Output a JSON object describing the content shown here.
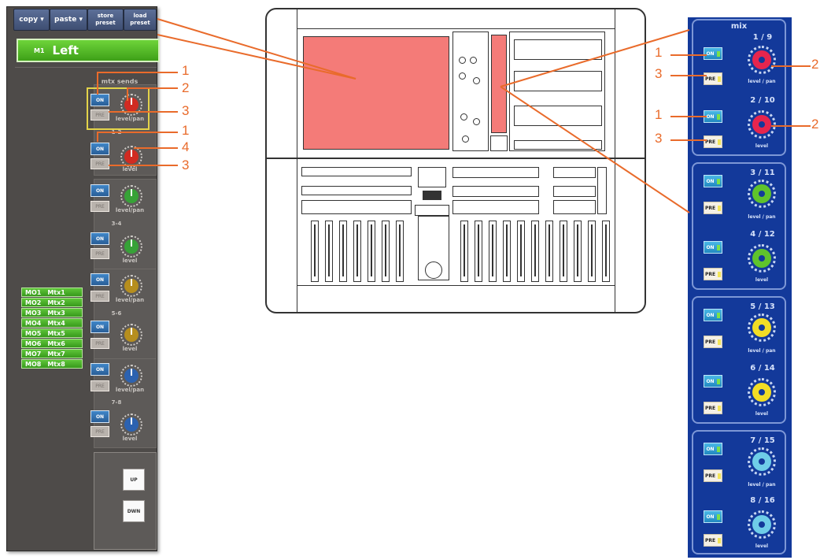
{
  "colors": {
    "callout": "#e96b2b",
    "highlight": "#f47b78",
    "left_strip": "#4e4b49",
    "right_panel": "#13399a",
    "channel_green": "#4fb828"
  },
  "left_strip": {
    "toolbar": {
      "copy": "copy",
      "paste": "paste",
      "store_preset": "store preset",
      "load_preset": "load preset"
    },
    "channel": {
      "index": "M1",
      "name": "Left"
    },
    "mtx_sends_title": "mtx sends",
    "pairs": [
      {
        "label": "1-2",
        "knob_color": "#d12b22",
        "top_caption": "level/pan",
        "bottom_caption": "level"
      },
      {
        "label": "3-4",
        "knob_color": "#37a237",
        "top_caption": "level/pan",
        "bottom_caption": "level"
      },
      {
        "label": "5-6",
        "knob_color": "#b68e1e",
        "top_caption": "level/pan",
        "bottom_caption": "level"
      },
      {
        "label": "7-8",
        "knob_color": "#2c62b0",
        "top_caption": "level/pan",
        "bottom_caption": "level"
      }
    ],
    "on_label": "ON",
    "pre_label": "PRE",
    "matrix_outputs": [
      {
        "id": "MO1",
        "name": "Mtx1"
      },
      {
        "id": "MO2",
        "name": "Mtx2"
      },
      {
        "id": "MO3",
        "name": "Mtx3"
      },
      {
        "id": "MO4",
        "name": "Mtx4"
      },
      {
        "id": "MO5",
        "name": "Mtx5"
      },
      {
        "id": "MO6",
        "name": "Mtx6"
      },
      {
        "id": "MO7",
        "name": "Mtx7"
      },
      {
        "id": "MO8",
        "name": "Mtx8"
      }
    ],
    "up_label": "UP",
    "down_label": "DWN"
  },
  "left_callouts": [
    "1",
    "2",
    "3",
    "1",
    "4",
    "3"
  ],
  "right_callouts": [
    "1",
    "3",
    "1",
    "3"
  ],
  "right_panel": {
    "title": "mix",
    "on_label": "ON",
    "pre_label": "PRE",
    "groups": [
      {
        "knob_color": "#e6254e",
        "sends": [
          {
            "label": "1 / 9",
            "caption": "level / pan"
          },
          {
            "label": "2 / 10",
            "caption": "level"
          }
        ]
      },
      {
        "knob_color": "#5fc32c",
        "sends": [
          {
            "label": "3 / 11",
            "caption": "level / pan"
          },
          {
            "label": "4 / 12",
            "caption": "level"
          }
        ]
      },
      {
        "knob_color": "#f2dd25",
        "sends": [
          {
            "label": "5 / 13",
            "caption": "level / pan"
          },
          {
            "label": "6 / 14",
            "caption": "level"
          }
        ]
      },
      {
        "knob_color": "#6fcde8",
        "sends": [
          {
            "label": "7 / 15",
            "caption": "level / pan"
          },
          {
            "label": "8 / 16",
            "caption": "level"
          }
        ]
      }
    ]
  }
}
